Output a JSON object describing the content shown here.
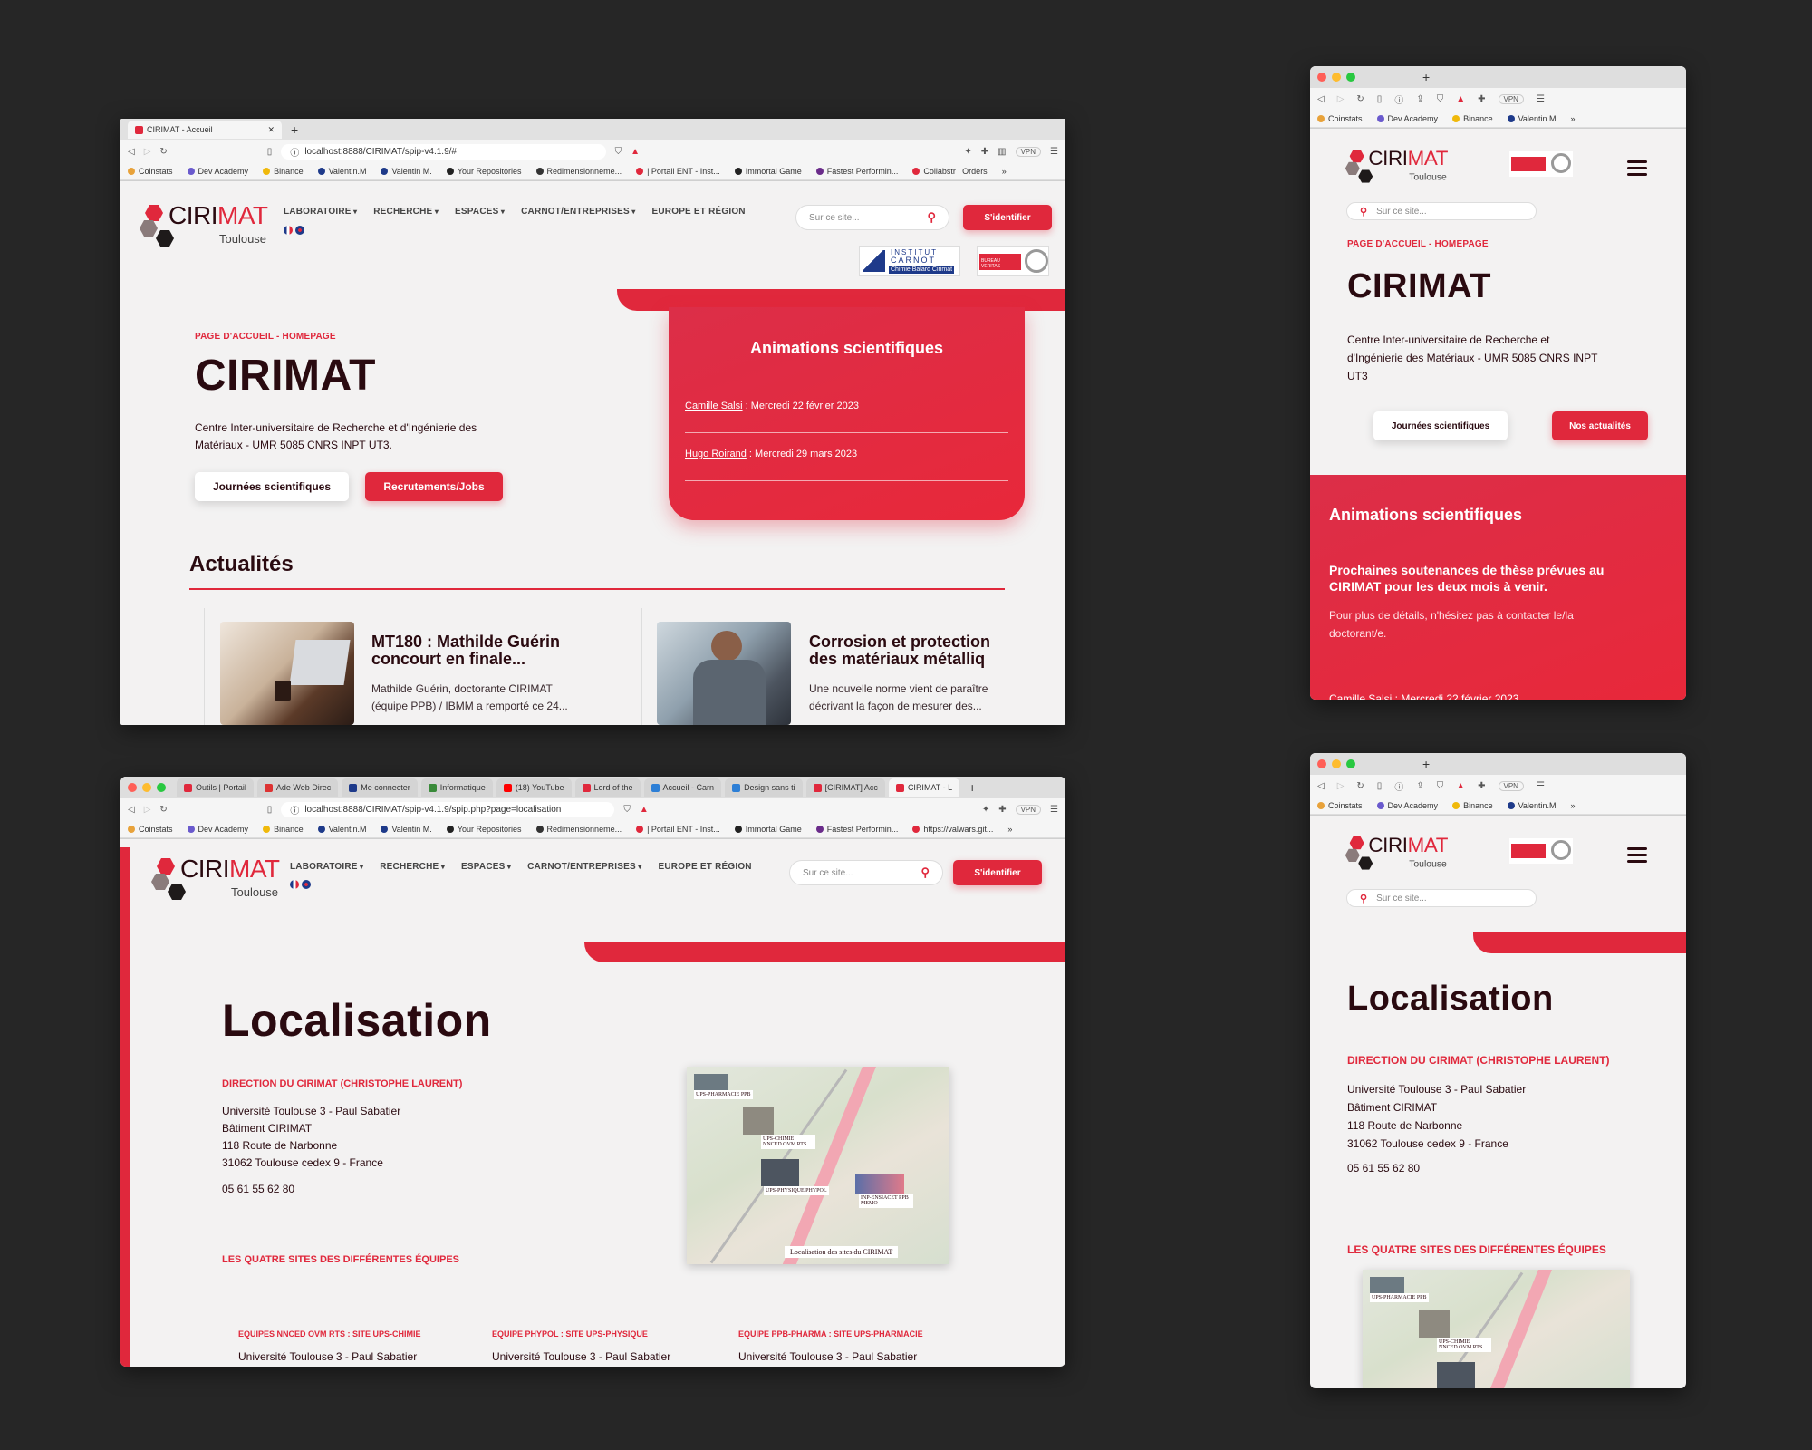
{
  "win1": {
    "tab_title": "CIRIMAT - Accueil",
    "url": "localhost:8888/CIRIMAT/spip-v4.1.9/#",
    "bookmarks": [
      "Coinstats",
      "Dev Academy",
      "Binance",
      "Valentin.M",
      "Valentin M.",
      "Your Repositories",
      "Redimensionneme...",
      "| Portail ENT - Inst...",
      "Immortal Game",
      "Fastest Performin...",
      "Collabstr | Orders"
    ],
    "vpn": "VPN"
  },
  "site": {
    "logo_ciri": "CIRI",
    "logo_mat": "MAT",
    "logo_city": "Toulouse",
    "nav": [
      "LABORATOIRE",
      "RECHERCHE",
      "ESPACES",
      "CARNOT/ENTREPRISES",
      "EUROPE ET RÉGION"
    ],
    "search_placeholder": "Sur ce site...",
    "login": "S'identifier",
    "carnot_line1": "INSTITUT",
    "carnot_line2": "CARNOT",
    "carnot_line3": "Chimie Balard Cirimat",
    "bv_text": "BUREAU VERITAS"
  },
  "home": {
    "kicker": "PAGE D'ACCUEIL - HOMEPAGE",
    "title": "CIRIMAT",
    "desc_line1": "Centre Inter-universitaire de Recherche et d'Ingénierie des",
    "desc_line2": "Matériaux - UMR 5085 CNRS INPT UT3.",
    "btn_journees": "Journées scientifiques",
    "btn_jobs": "Recrutements/Jobs",
    "anim_title": "Animations scientifiques",
    "events": [
      {
        "name": "Camille Salsi",
        "date": " : Mercredi 22 février 2023"
      },
      {
        "name": "Hugo Roirand",
        "date": " : Mercredi 29 mars 2023"
      }
    ],
    "news_heading": "Actualités",
    "news": [
      {
        "title_line1": "MT180 : Mathilde Guérin",
        "title_line2": "concourt en finale...",
        "excerpt_line1": "Mathilde Guérin, doctorante CIRIMAT",
        "excerpt_line2": "(équipe PPB) / IBMM a remporté ce 24..."
      },
      {
        "title_line1": "Corrosion et protection",
        "title_line2": "des matériaux métalliq",
        "excerpt_line1": "Une nouvelle norme vient de paraître",
        "excerpt_line2": "décrivant la façon de mesurer des..."
      }
    ]
  },
  "win2": {
    "tabs": [
      "Outils | Portail",
      "Ade Web Direc",
      "Me connecter",
      "Informatique",
      "(18) YouTube",
      "Lord of the",
      "Accueil - Carn",
      "Design sans ti",
      "[CIRIMAT] Acc",
      "CIRIMAT - L"
    ],
    "url": "localhost:8888/CIRIMAT/spip-v4.1.9/spip.php?page=localisation",
    "bookmarks": [
      "Coinstats",
      "Dev Academy",
      "Binance",
      "Valentin.M",
      "Valentin M.",
      "Your Repositories",
      "Redimensionneme...",
      "| Portail ENT - Inst...",
      "Immortal Game",
      "Fastest Performin...",
      "https://valwars.git..."
    ]
  },
  "loc": {
    "title": "Localisation",
    "direction_heading": "DIRECTION DU CIRIMAT (CHRISTOPHE LAURENT)",
    "address": [
      "Université Toulouse 3 - Paul Sabatier",
      "Bâtiment CIRIMAT",
      "118 Route de Narbonne",
      "31062 Toulouse cedex 9 - France"
    ],
    "phone": "05 61 55 62 80",
    "sites_heading": "LES QUATRE SITES DES DIFFÉRENTES ÉQUIPES",
    "teams": [
      {
        "heading": "EQUIPES NNCED OVM RTS : SITE UPS-CHIMIE",
        "line": "Université Toulouse 3 - Paul Sabatier"
      },
      {
        "heading": "EQUIPE PHYPOL : SITE UPS-PHYSIQUE",
        "line": "Université Toulouse 3 - Paul Sabatier"
      },
      {
        "heading": "EQUIPE PPB-PHARMA : SITE UPS-PHARMACIE",
        "line": "Université Toulouse 3 - Paul Sabatier"
      }
    ],
    "map_labels": [
      "UPS-PHARMACIE PPB",
      "UPS-CHIMIE NNCED OVM RTS",
      "UPS-PHYSIQUE PHYPOL",
      "INP-ENSIACET PPB MEMO"
    ],
    "map_caption": "Localisation des sites du CIRIMAT"
  },
  "mobile": {
    "bookmarks": [
      "Coinstats",
      "Dev Academy",
      "Binance",
      "Valentin.M"
    ],
    "btn_actualites": "Nos actualités",
    "desc_lines": [
      "Centre Inter-universitaire de Recherche et",
      "d'Ingénierie des Matériaux - UMR 5085 CNRS INPT",
      "UT3"
    ],
    "anim_sub_line1": "Prochaines soutenances de thèse prévues au",
    "anim_sub_line2": "CIRIMAT pour les deux mois à venir.",
    "anim_note_line1": "Pour plus de détails, n'hésitez pas à contacter le/la",
    "anim_note_line2": "doctorant/e.",
    "anim_event": "Camille Salsi : Mercredi 22 février 2023"
  }
}
